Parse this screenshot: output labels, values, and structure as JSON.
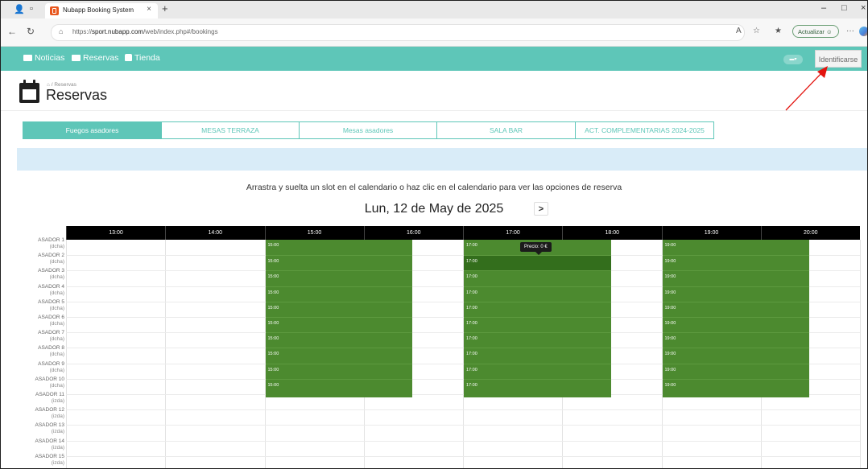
{
  "browser": {
    "tab_title": "Nubapp Booking System",
    "tab_close": "×",
    "new_tab": "+",
    "url_prefix": "https://",
    "url_host": "sport.nubapp.com",
    "url_path": "/web/index.php#/bookings",
    "update_label": "Actualizar",
    "window_controls": {
      "minimize": "–",
      "maximize": "□",
      "close": "×"
    }
  },
  "navbar": {
    "items": [
      {
        "label": "Noticias",
        "icon": "news-icon"
      },
      {
        "label": "Reservas",
        "icon": "calendar-icon"
      },
      {
        "label": "Tienda",
        "icon": "shopping-bag-icon"
      }
    ],
    "language_label": "▾",
    "login_label": "Identificarse",
    "color": "#5ec6b8"
  },
  "header": {
    "breadcrumb": "/ Reservas",
    "title": "Reservas"
  },
  "resource_tabs": [
    {
      "label": "Fuegos asadores",
      "active": true
    },
    {
      "label": "MESAS TERRAZA",
      "active": false
    },
    {
      "label": "Mesas asadores",
      "active": false
    },
    {
      "label": "SALA BAR",
      "active": false
    },
    {
      "label": "ACT. COMPLEMENTARIAS 2024-2025",
      "active": false
    }
  ],
  "hint": "Arrastra y suelta un slot en el calendario o haz clic en el calendario para ver las opciones de reserva",
  "date": "Lun, 12 de May de 2025",
  "next_label": ">",
  "scheduler": {
    "hours": [
      "13:00",
      "14:00",
      "15:00",
      "16:00",
      "17:00",
      "18:00",
      "19:00",
      "20:00"
    ],
    "rows": [
      {
        "name": "ASADOR 1",
        "side": "(dcha)"
      },
      {
        "name": "ASADOR 2",
        "side": "(dcha)"
      },
      {
        "name": "ASADOR 3",
        "side": "(dcha)"
      },
      {
        "name": "ASADOR 4",
        "side": "(dcha)"
      },
      {
        "name": "ASADOR 5",
        "side": "(dcha)"
      },
      {
        "name": "ASADOR 6",
        "side": "(dcha)"
      },
      {
        "name": "ASADOR 7",
        "side": "(dcha)"
      },
      {
        "name": "ASADOR 8",
        "side": "(dcha)"
      },
      {
        "name": "ASADOR 9",
        "side": "(dcha)"
      },
      {
        "name": "ASADOR 10",
        "side": "(dcha)"
      },
      {
        "name": "ASADOR 11",
        "side": "(izda)"
      },
      {
        "name": "ASADOR 12",
        "side": "(izda)"
      },
      {
        "name": "ASADOR 13",
        "side": "(izda)"
      },
      {
        "name": "ASADOR 14",
        "side": "(izda)"
      },
      {
        "name": "ASADOR 15",
        "side": "(izda)"
      }
    ],
    "blocks": [
      {
        "start": "15:00",
        "slots": [
          "15:00",
          "15:00",
          "15:00",
          "15:00",
          "15:00",
          "15:00",
          "15:00",
          "15:00",
          "15:00",
          "15:00"
        ]
      },
      {
        "start": "17:00",
        "slots": [
          "17:00",
          "17:00",
          "17:00",
          "17:00",
          "17:00",
          "17:00",
          "17:00",
          "17:00",
          "17:00",
          "17:00"
        ],
        "highlight_row": 1
      },
      {
        "start": "19:00",
        "slots": [
          "19:00",
          "19:00",
          "19:00",
          "19:00",
          "19:00",
          "19:00",
          "19:00",
          "19:00",
          "19:00",
          "19:00"
        ]
      }
    ],
    "tooltip": "Precio: 0 €",
    "slot_color": "#4c8a2f"
  }
}
